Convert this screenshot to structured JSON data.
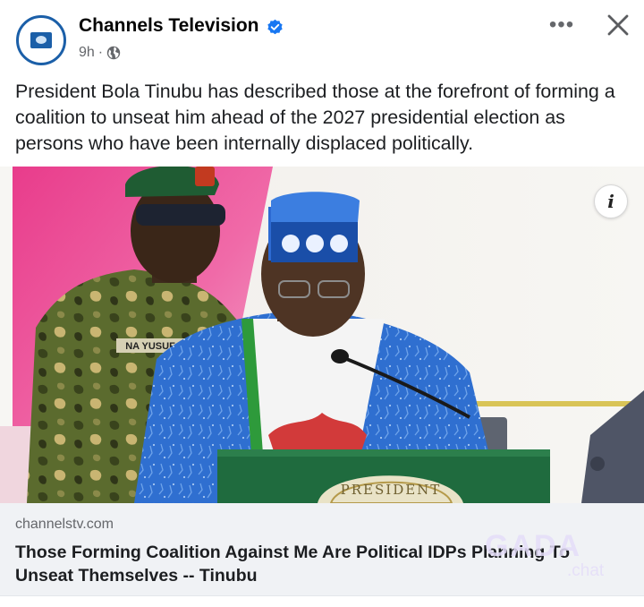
{
  "post": {
    "page_name": "Channels Television",
    "timestamp": "9h",
    "meta_separator": "·",
    "audience_icon": "globe-icon",
    "verified_icon": "verified-badge-icon",
    "text": "President Bola Tinubu has described those at the forefront of forming a coalition to unseat him ahead of the 2027 presidential election as persons who have been internally displaced politically."
  },
  "actions": {
    "more_label": "•••",
    "close_icon": "close-icon"
  },
  "photo": {
    "info_label": "i",
    "name_tag": "NA YUSUF",
    "podium_text": "PRESIDENT"
  },
  "link": {
    "domain": "channelstv.com",
    "title": "Those Forming Coalition Against Me Are Political IDPs Planning To Unseat Themselves -- Tinubu"
  },
  "watermark": {
    "brand": "GADA",
    "suffix": ".chat"
  },
  "colors": {
    "accent": "#1877f2",
    "logo_blue": "#1b5fa8",
    "agbada_blue": "#2f6fd0",
    "camouflage": "#5b6b2e"
  }
}
